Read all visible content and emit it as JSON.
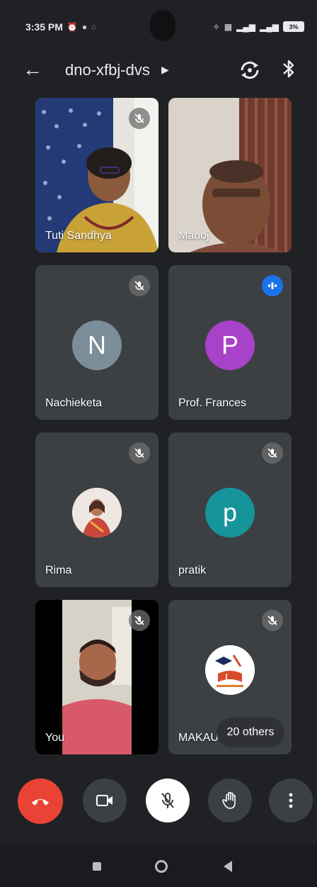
{
  "status_bar": {
    "time": "3:35 PM",
    "battery": "3%"
  },
  "header": {
    "meeting_code": "dno-xfbj-dvs"
  },
  "tiles": [
    {
      "name": "Tuti Sandhya",
      "muted": true,
      "type": "video"
    },
    {
      "name": "Manoj",
      "muted": false,
      "type": "video"
    },
    {
      "name": "Nachieketa",
      "muted": true,
      "type": "avatar",
      "initial": "N",
      "avatar_color": "#7b8e9a"
    },
    {
      "name": "Prof. Frances",
      "muted": false,
      "speaking": true,
      "type": "avatar",
      "initial": "P",
      "avatar_color": "#a842c8"
    },
    {
      "name": "Rima",
      "muted": true,
      "type": "photo-avatar"
    },
    {
      "name": "pratik",
      "muted": true,
      "type": "avatar",
      "initial": "p",
      "avatar_color": "#15949a"
    },
    {
      "name": "You",
      "muted": true,
      "type": "video"
    },
    {
      "name": "MAKAU",
      "muted": true,
      "type": "logo-avatar"
    }
  ],
  "others_chip": "20 others",
  "controls": {
    "end_call": "end-call-icon",
    "camera": "video-camera-icon",
    "mic": "mic-off-icon",
    "raise_hand": "raise-hand-icon",
    "more": "more-vert-icon"
  },
  "colors": {
    "background": "#202124",
    "tile": "#3c4043",
    "end_call": "#ea4335",
    "speaking": "#1a73e8"
  }
}
